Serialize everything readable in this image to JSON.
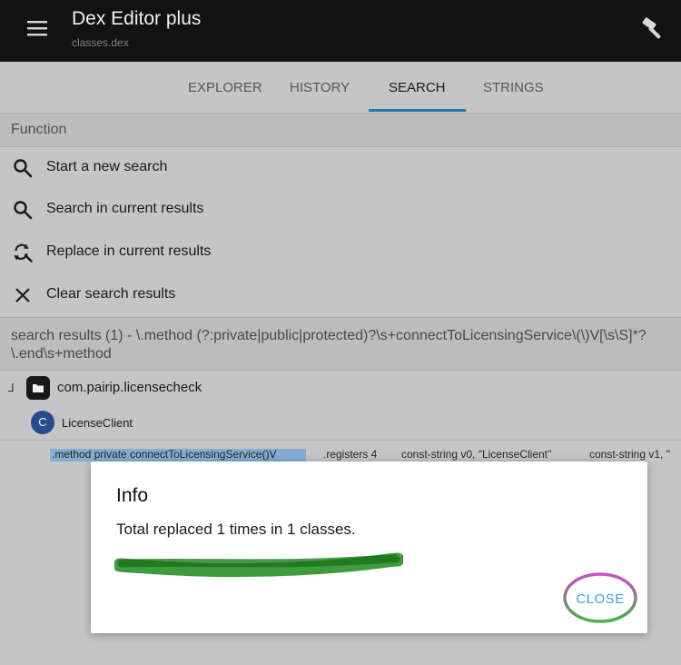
{
  "appbar": {
    "title": "Dex Editor plus",
    "subtitle": "classes.dex",
    "menu_icon": "menu-icon",
    "action_icon": "hammer-icon"
  },
  "tabs": [
    {
      "label": "EXPLORER"
    },
    {
      "label": "HISTORY"
    },
    {
      "label": "SEARCH",
      "active": true
    },
    {
      "label": "STRINGS"
    }
  ],
  "function_section": {
    "header": "Function",
    "items": [
      {
        "icon": "search-icon",
        "label": "Start a new search"
      },
      {
        "icon": "search-icon",
        "label": "Search in current results"
      },
      {
        "icon": "replace-icon",
        "label": "Replace in current results"
      },
      {
        "icon": "close-icon",
        "label": "Clear search results"
      }
    ]
  },
  "results": {
    "header": "search results (1) - \\.method (?:private|public|protected)?\\s+connectToLicensingService\\(\\)V[\\s\\S]*?\\.end\\s+method",
    "tree_expander": "⅃",
    "package": "com.pairip.licensecheck",
    "class_badge": "C",
    "class_name": "LicenseClient",
    "result_segments": [
      ".method private connectToLicensingService()V",
      ".registers 4",
      "const-string v0, \"LicenseClient\"",
      "const-string v1, \""
    ]
  },
  "dialog": {
    "title": "Info",
    "message": "Total replaced 1 times in 1 classes.",
    "close_label": "CLOSE"
  },
  "colors": {
    "appbar": "#141414",
    "tab_indicator": "#2d7fb8",
    "class_badge": "#2c4f94",
    "close_label": "#3b9fe0",
    "scribble": "#1f8a1f",
    "close_ring": "#c94fc4"
  }
}
